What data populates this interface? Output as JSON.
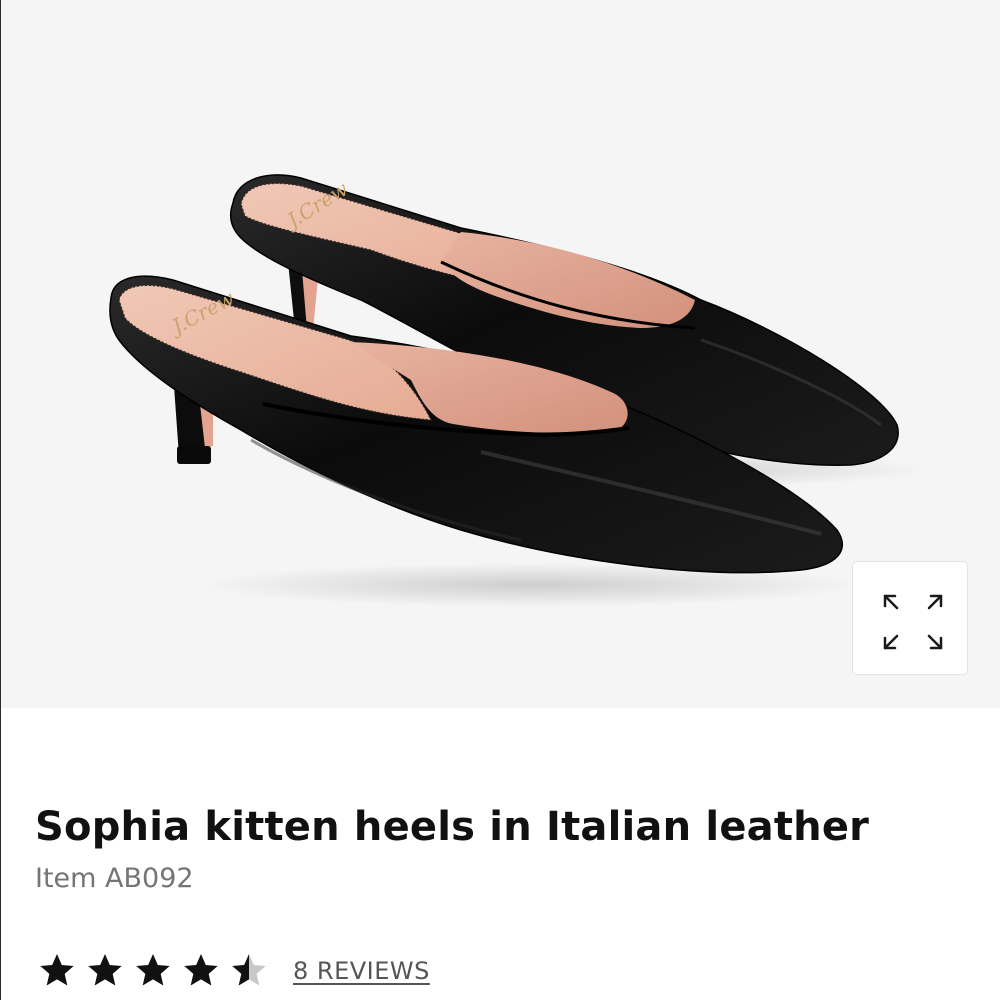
{
  "product": {
    "image_alt": "Black patent pointed-toe mules with pink lining and kitten heels",
    "insole_logo_text": "J.Crew",
    "title": "Sophia kitten heels in Italian leather",
    "item_code": "Item AB092"
  },
  "rating": {
    "value": 4.5,
    "max": 5,
    "reviews_label": "8 REVIEWS"
  },
  "icons": {
    "expand": "expand-arrows-icon",
    "star": "star-icon"
  },
  "colors": {
    "hero_background": "#f5f5f6",
    "star_filled": "#111111",
    "star_empty": "#c8c8c8",
    "shoe_leather": "#0d0d0d",
    "shoe_lining": "#e9b5a0"
  }
}
